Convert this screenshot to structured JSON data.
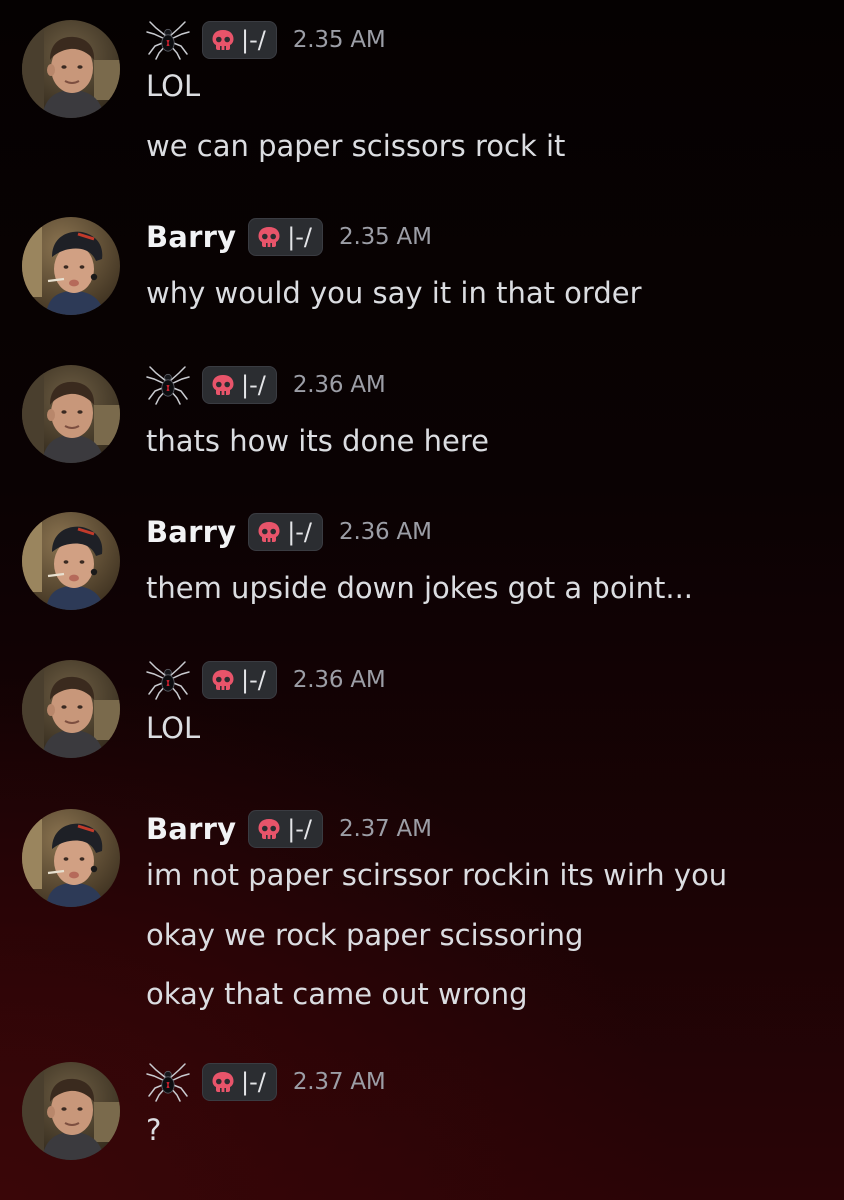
{
  "tag_label": "|-/",
  "accent_colors": {
    "skull": "#e8546a",
    "tag_bg": "#2b2d31",
    "timestamp": "#9c9ea6"
  },
  "messages": [
    {
      "author": "",
      "author_icon": "spider-icon",
      "time": "2.35 AM",
      "lines": [
        "LOL",
        "we can paper scissors rock it"
      ]
    },
    {
      "author": "Barry",
      "author_icon": "",
      "time": "2.35 AM",
      "lines": [
        "why would you say it in that order"
      ]
    },
    {
      "author": "",
      "author_icon": "spider-icon",
      "time": "2.36 AM",
      "lines": [
        "thats how its done here"
      ]
    },
    {
      "author": "Barry",
      "author_icon": "",
      "time": "2.36 AM",
      "lines": [
        "them upside down jokes got a point..."
      ]
    },
    {
      "author": "",
      "author_icon": "spider-icon",
      "time": "2.36 AM",
      "lines": [
        "LOL"
      ]
    },
    {
      "author": "Barry",
      "author_icon": "",
      "time": "2.37 AM",
      "lines": [
        "im not paper scirssor rockin its wirh you",
        "okay we rock paper scissoring",
        "okay that came out wrong"
      ]
    },
    {
      "author": "",
      "author_icon": "spider-icon",
      "time": "2.37 AM",
      "lines": [
        "?"
      ]
    }
  ]
}
